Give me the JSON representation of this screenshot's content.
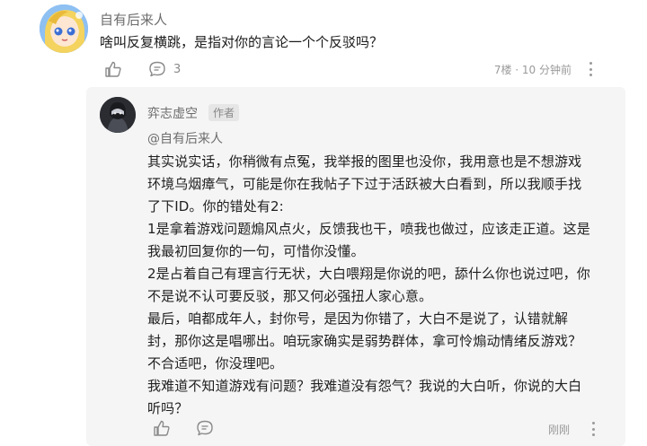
{
  "top_comment": {
    "username": "自有后来人",
    "text": "啥叫反复横跳，是指对你的言论一个个反驳吗？",
    "reply_count": "3",
    "meta": "7楼 · 10 分钟前"
  },
  "reply": {
    "username": "弈志虚空",
    "author_badge": "作者",
    "mention": "@自有后来人",
    "lines": [
      "其实说实话，你稍微有点冤，我举报的图里也没你，我用意也是不想游戏",
      "环境乌烟瘴气，可能是你在我帖子下过于活跃被大白看到，所以我顺手找",
      "了下ID。你的错处有2:",
      "1是拿着游戏问题煽风点火，反馈我也干，喷我也做过，应该走正道。这是",
      "我最初回复你的一句，可惜你没懂。",
      "2是占着自己有理言行无状，大白喂翔是你说的吧，舔什么你也说过吧，你",
      "不是说不认可要反驳，那又何必强扭人家心意。",
      "最后，咱都成年人，封你号，是因为你错了，大白不是说了，认错就解",
      "封，那你这是唱哪出。咱玩家确实是弱势群体，拿可怜煽动情绪反游戏？",
      "不合适吧，你没理吧。",
      "我难道不知道游戏有问题？我难道没有怨气？我说的大白听，你说的大白",
      "听吗？"
    ],
    "meta": "刚刚"
  },
  "icons": {
    "like": "thumbs-up-icon",
    "comment": "comment-bubble-icon",
    "more": "more-vertical-icon"
  },
  "colors": {
    "reply_background": "#f5f5f5",
    "secondary_text": "#8a8a8a"
  }
}
